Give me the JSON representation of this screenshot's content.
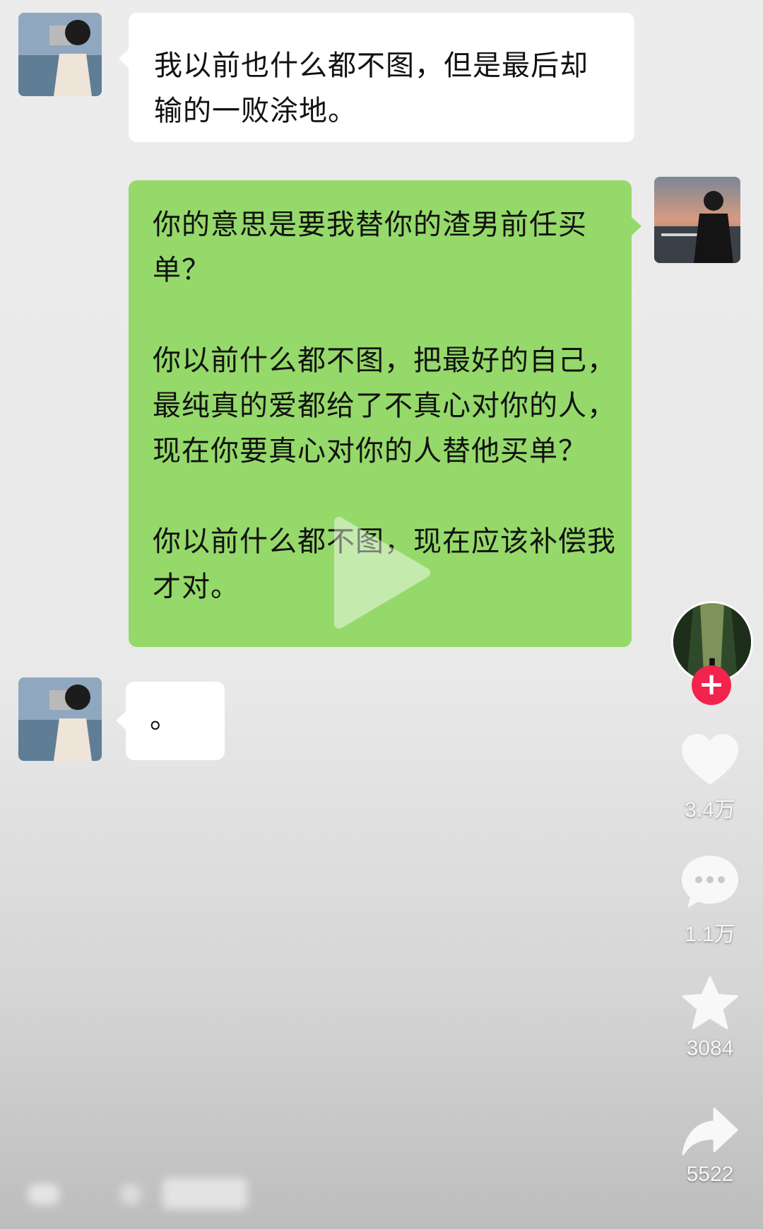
{
  "chat": {
    "messages": [
      {
        "side": "left",
        "text": "我以前也什么都不图，但是最后却输的一败涂地。"
      },
      {
        "side": "right",
        "paragraphs": [
          "你的意思是要我替你的渣男前任买单？",
          "你以前什么都不图，把最好的自己，最纯真的爱都给了不真心对你的人，现在你要真心对你的人替他买单？",
          "你以前什么都不图，现在应该补偿我才对。"
        ]
      },
      {
        "side": "left",
        "text": "。"
      }
    ]
  },
  "side_rail": {
    "follow_icon": "plus-icon",
    "like": {
      "icon": "heart-icon",
      "count": "3.4万"
    },
    "comment": {
      "icon": "comment-icon",
      "count": "1.1万"
    },
    "favorite": {
      "icon": "star-icon",
      "count": "3084"
    },
    "share": {
      "icon": "share-icon",
      "count": "5522"
    }
  },
  "colors": {
    "sent_bubble": "#95d96a",
    "received_bubble": "#ffffff",
    "follow_plus": "#f2234d"
  }
}
